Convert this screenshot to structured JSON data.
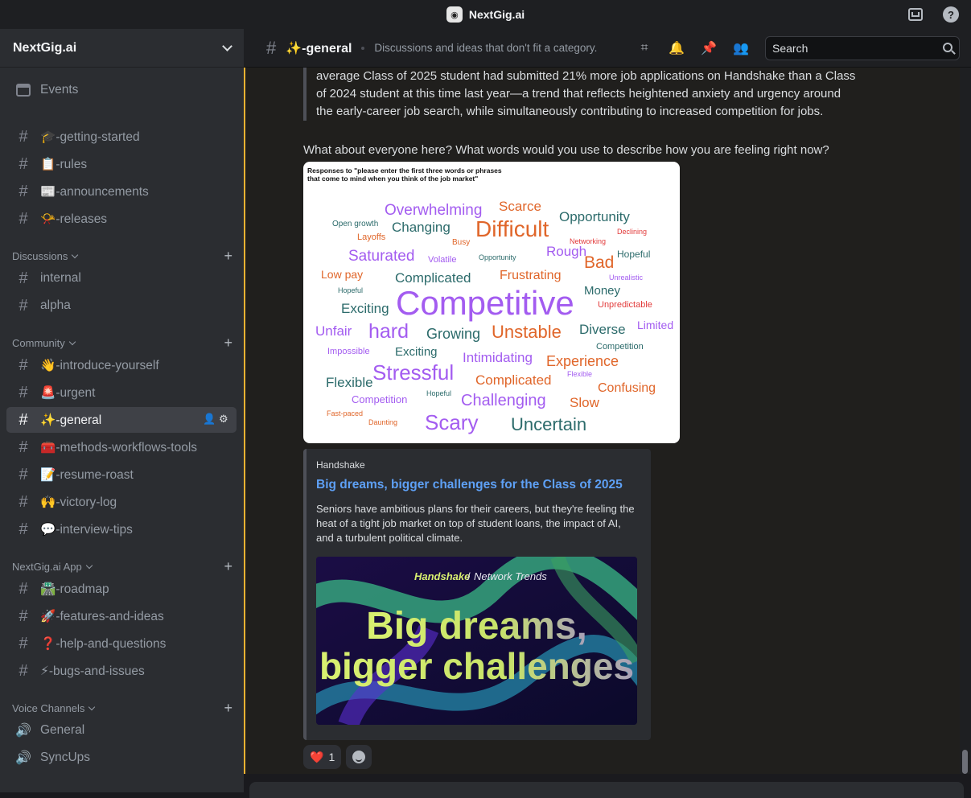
{
  "window": {
    "title": "NextGig.ai"
  },
  "sidebar": {
    "server_name": "NextGig.ai",
    "events_label": "Events",
    "top_channels": [
      {
        "emoji": "🎓",
        "name": "-getting-started"
      },
      {
        "emoji": "📋",
        "name": "-rules"
      },
      {
        "emoji": "📰",
        "name": "-announcements"
      },
      {
        "emoji": "📯",
        "name": "-releases"
      }
    ],
    "categories": {
      "discussions": "Discussions",
      "community": "Community",
      "app": "NextGig.ai App",
      "voice": "Voice Channels"
    },
    "discussion_channels": [
      "internal",
      "alpha"
    ],
    "community_channels": [
      {
        "emoji": "👋",
        "name": "-introduce-yourself"
      },
      {
        "emoji": "🚨",
        "name": "-urgent"
      },
      {
        "emoji": "✨",
        "name": "-general"
      },
      {
        "emoji": "🧰",
        "name": "-methods-workflows-tools"
      },
      {
        "emoji": "📝",
        "name": "-resume-roast"
      },
      {
        "emoji": "🙌",
        "name": "-victory-log"
      },
      {
        "emoji": "💬",
        "name": "-interview-tips"
      }
    ],
    "app_channels": [
      {
        "emoji": "🛣️",
        "name": "-roadmap"
      },
      {
        "emoji": "🚀",
        "name": "-features-and-ideas"
      },
      {
        "emoji": "❓",
        "name": "-help-and-questions"
      },
      {
        "emoji": "⚡",
        "name": "-bugs-and-issues"
      }
    ],
    "voice_channels": [
      "General",
      "SyncUps"
    ]
  },
  "header": {
    "channel": "✨-general",
    "topic": "Discussions and ideas that don't fit a category.",
    "search_placeholder": "Search"
  },
  "message": {
    "quote_lines": [
      "average Class of 2025 student had submitted 21% more job applications on Handshake than a Class",
      "of 2024 student at this time last year—a trend that reflects heightened anxiety and urgency around",
      "the early-career job search, while simultaneously contributing to increased competition for jobs."
    ],
    "text": "What about everyone here? What words would you use to describe how you are feeling right now?",
    "wordcloud": {
      "title_line1": "Responses to \"please enter the first three words or phrases",
      "title_line2": "that come to mind when you think of the job market\"",
      "colors": {
        "purple": "#a35cf0",
        "teal": "#2c6b6b",
        "orange": "#e0662a",
        "red": "#e23b3b"
      },
      "words": [
        {
          "t": "Overwhelming",
          "c": "purple"
        },
        {
          "t": "Scarce",
          "c": "orange"
        },
        {
          "t": "Opportunity",
          "c": "teal"
        },
        {
          "t": "Open growth",
          "c": "teal"
        },
        {
          "t": "Changing",
          "c": "teal"
        },
        {
          "t": "Difficult",
          "c": "orange"
        },
        {
          "t": "Layoffs",
          "c": "orange"
        },
        {
          "t": "Busy",
          "c": "orange"
        },
        {
          "t": "Networking",
          "c": "red"
        },
        {
          "t": "Declining",
          "c": "red"
        },
        {
          "t": "Saturated",
          "c": "purple"
        },
        {
          "t": "Volatile",
          "c": "purple"
        },
        {
          "t": "Opportunity",
          "c": "teal"
        },
        {
          "t": "Rough",
          "c": "purple"
        },
        {
          "t": "Bad",
          "c": "orange"
        },
        {
          "t": "Hopeful",
          "c": "teal"
        },
        {
          "t": "Low pay",
          "c": "orange"
        },
        {
          "t": "Complicated",
          "c": "teal"
        },
        {
          "t": "Frustrating",
          "c": "orange"
        },
        {
          "t": "Unrealistic",
          "c": "purple"
        },
        {
          "t": "Hopeful",
          "c": "teal"
        },
        {
          "t": "Money",
          "c": "teal"
        },
        {
          "t": "Exciting",
          "c": "teal"
        },
        {
          "t": "Competitive",
          "c": "purple"
        },
        {
          "t": "Unpredictable",
          "c": "red"
        },
        {
          "t": "Unfair",
          "c": "purple"
        },
        {
          "t": "hard",
          "c": "purple"
        },
        {
          "t": "Growing",
          "c": "teal"
        },
        {
          "t": "Unstable",
          "c": "orange"
        },
        {
          "t": "Diverse",
          "c": "teal"
        },
        {
          "t": "Limited",
          "c": "purple"
        },
        {
          "t": "Impossible",
          "c": "purple"
        },
        {
          "t": "Exciting",
          "c": "teal"
        },
        {
          "t": "Intimidating",
          "c": "purple"
        },
        {
          "t": "Competition",
          "c": "teal"
        },
        {
          "t": "Experience",
          "c": "orange"
        },
        {
          "t": "Flexible",
          "c": "teal"
        },
        {
          "t": "Stressful",
          "c": "purple"
        },
        {
          "t": "Complicated",
          "c": "orange"
        },
        {
          "t": "Flexible",
          "c": "purple"
        },
        {
          "t": "Confusing",
          "c": "orange"
        },
        {
          "t": "Competition",
          "c": "purple"
        },
        {
          "t": "Hopeful",
          "c": "teal"
        },
        {
          "t": "Challenging",
          "c": "purple"
        },
        {
          "t": "Slow",
          "c": "orange"
        },
        {
          "t": "Fast-paced",
          "c": "orange"
        },
        {
          "t": "Daunting",
          "c": "orange"
        },
        {
          "t": "Scary",
          "c": "purple"
        },
        {
          "t": "Uncertain",
          "c": "teal"
        }
      ]
    },
    "embed": {
      "provider": "Handshake",
      "title": "Big dreams, bigger challenges for the Class of 2025",
      "description": "Seniors have ambitious plans for their careers, but they're feeling the heat of a tight job market on top of student loans, the impact of AI, and a turbulent political climate.",
      "image_brand": "Handshake",
      "image_tag": "Network Trends",
      "image_line1": "Big dreams,",
      "image_line2": "bigger challenges"
    },
    "reactions": [
      {
        "emoji": "❤️",
        "count": "1"
      }
    ]
  }
}
